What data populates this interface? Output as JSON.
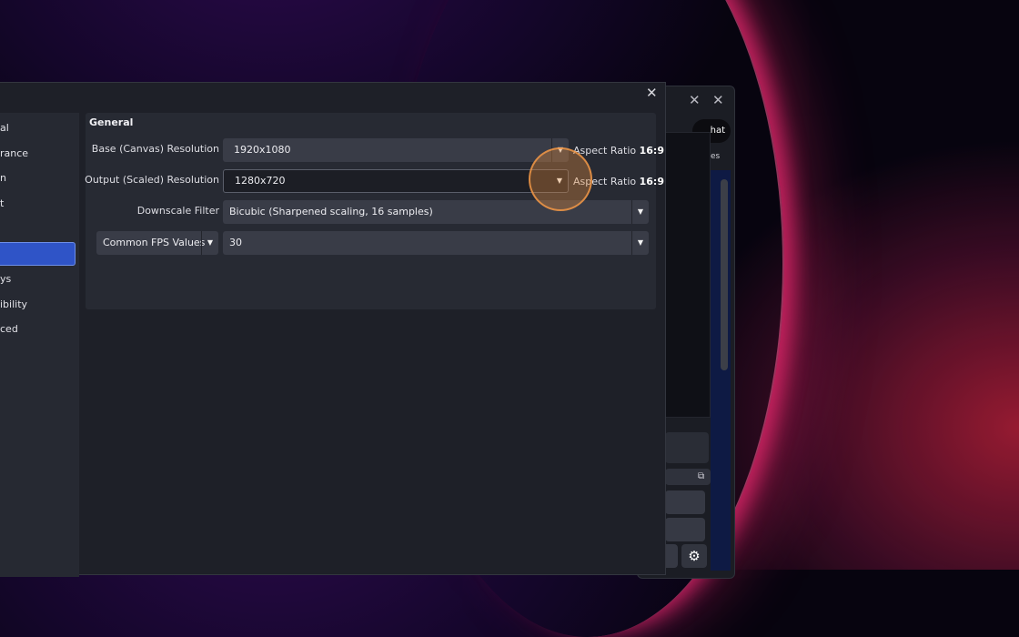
{
  "background_window": {
    "chat_label": "hat",
    "scenes_label": "es"
  },
  "dialog": {
    "sidebar": {
      "items": [
        {
          "label": "al"
        },
        {
          "label": "rance"
        },
        {
          "label": "n"
        },
        {
          "label": "t"
        },
        {
          "label": ""
        },
        {
          "label": "ys"
        },
        {
          "label": "ibility"
        },
        {
          "label": "ced"
        }
      ],
      "selected_index": 4
    },
    "group_title": "General",
    "rows": {
      "base_resolution": {
        "label": "Base (Canvas) Resolution",
        "value": "1920x1080",
        "aspect_prefix": "Aspect Ratio",
        "aspect_value": "16:9"
      },
      "output_resolution": {
        "label": "Output (Scaled) Resolution",
        "value": "1280x720",
        "aspect_prefix": "Aspect Ratio",
        "aspect_value": "16:9"
      },
      "downscale_filter": {
        "label": "Downscale Filter",
        "value": "Bicubic (Sharpened scaling, 16 samples)"
      },
      "fps": {
        "type_value": "Common FPS Values",
        "value": "30"
      }
    }
  },
  "colors": {
    "accent_selected": "#2f54c7",
    "cursor_highlight": "#e88c3c"
  },
  "icons": {
    "close": "close-icon",
    "dropdown": "chevron-down-icon",
    "gear": "gear-icon"
  }
}
